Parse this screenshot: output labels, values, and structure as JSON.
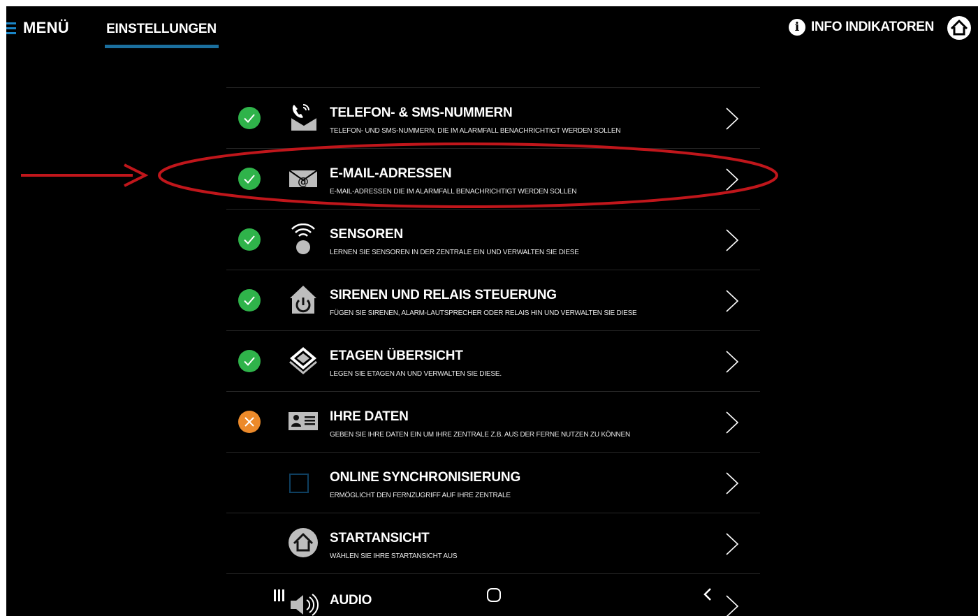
{
  "header": {
    "menu_label": "MENÜ",
    "tab_label": "EINSTELLUNGEN",
    "info_label": "INFO INDIKATOREN"
  },
  "colors": {
    "ok": "#2fb34a",
    "error": "#ec8a2a",
    "accent": "#1b6f9e",
    "annotation": "#c0161b"
  },
  "rows": [
    {
      "title": "TELEFON- & SMS-NUMMERN",
      "subtitle": "TELEFON- UND SMS-NUMMERN, DIE IM ALARMFALL BENACHRICHTIGT WERDEN SOLLEN",
      "status": "ok",
      "icon": "phone-message-icon"
    },
    {
      "title": "E-MAIL-ADRESSEN",
      "subtitle": "E-MAIL-ADRESSEN DIE IM ALARMFALL BENACHRICHTIGT WERDEN SOLLEN",
      "status": "ok",
      "icon": "email-at-icon"
    },
    {
      "title": "SENSOREN",
      "subtitle": "LERNEN SIE SENSOREN IN DER ZENTRALE EIN UND VERWALTEN SIE DIESE",
      "status": "ok",
      "icon": "wireless-sensor-icon"
    },
    {
      "title": "SIRENEN UND RELAIS STEUERUNG",
      "subtitle": "FÜGEN SIE SIRENEN, ALARM-LAUTSPRECHER ODER RELAIS HIN UND VERWALTEN SIE DIESE",
      "status": "ok",
      "icon": "home-power-icon"
    },
    {
      "title": "ETAGEN ÜBERSICHT",
      "subtitle": "LEGEN SIE ETAGEN AN UND VERWALTEN SIE DIESE.",
      "status": "ok",
      "icon": "layers-icon"
    },
    {
      "title": "IHRE DATEN",
      "subtitle": "GEBEN SIE IHRE DATEN EIN UM IHRE ZENTRALE Z.B. AUS DER FERNE NUTZEN ZU KÖNNEN",
      "status": "error",
      "icon": "id-card-icon"
    },
    {
      "title": "ONLINE SYNCHRONISIERUNG",
      "subtitle": "ERMÖGLICHT DEN FERNZUGRIFF AUF IHRE ZENTRALE",
      "status": "unchecked",
      "icon": "checkbox-icon"
    },
    {
      "title": "STARTANSICHT",
      "subtitle": "WÄHLEN SIE IHRE STARTANSICHT AUS",
      "status": "none",
      "icon": "home-circle-icon"
    },
    {
      "title": "AUDIO",
      "subtitle": "",
      "status": "none",
      "icon": "speaker-icon"
    }
  ]
}
